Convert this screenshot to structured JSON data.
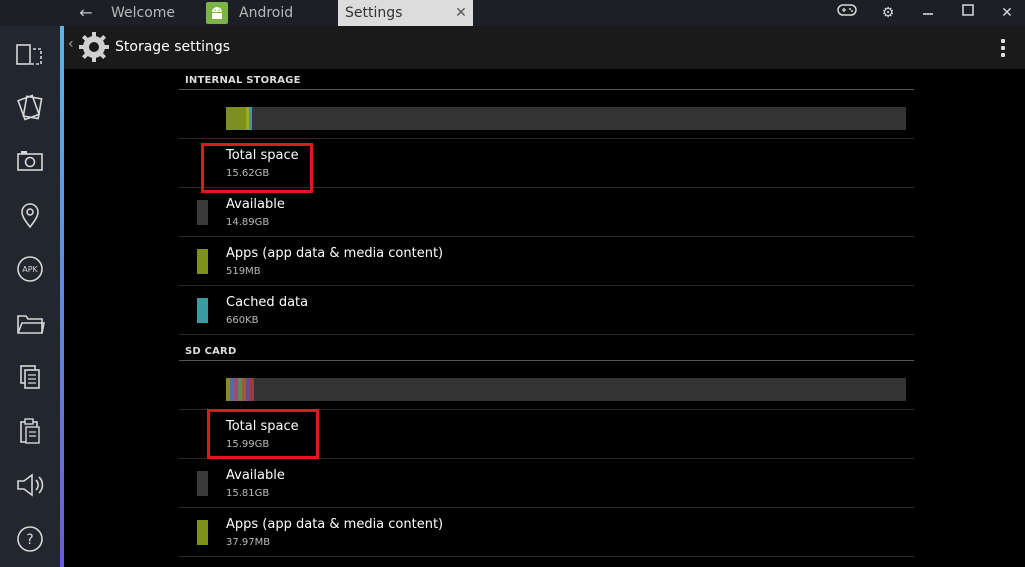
{
  "tabs": {
    "welcome": "Welcome",
    "android": "Android",
    "settings": "Settings"
  },
  "action_bar": {
    "title": "Storage settings"
  },
  "internal": {
    "header": "INTERNAL STORAGE",
    "usage": [
      {
        "name": "apps",
        "fraction": 0.03,
        "color": "#7d8f1c"
      },
      {
        "name": "other",
        "fraction": 0.004,
        "color": "#a0a820"
      },
      {
        "name": "cached",
        "fraction": 0.005,
        "color": "#3a9ca0"
      }
    ],
    "rows": [
      {
        "title": "Total space",
        "value": "15.62GB",
        "swatch": null
      },
      {
        "title": "Available",
        "value": "14.89GB",
        "swatch": "#3a3a3a"
      },
      {
        "title": "Apps (app data & media content)",
        "value": "519MB",
        "swatch": "#7d8f1c"
      },
      {
        "title": "Cached data",
        "value": "660KB",
        "swatch": "#3a9ca0"
      }
    ]
  },
  "sdcard": {
    "header": "SD CARD",
    "usage": [
      {
        "name": "s1",
        "fraction": 0.006,
        "color": "#8a8a2a"
      },
      {
        "name": "s2",
        "fraction": 0.006,
        "color": "#4a6fa0"
      },
      {
        "name": "s3",
        "fraction": 0.006,
        "color": "#a04a70"
      },
      {
        "name": "s4",
        "fraction": 0.006,
        "color": "#5a8a5a"
      },
      {
        "name": "s5",
        "fraction": 0.006,
        "color": "#a05a3a"
      },
      {
        "name": "s6",
        "fraction": 0.006,
        "color": "#6a4a8a"
      },
      {
        "name": "s7",
        "fraction": 0.006,
        "color": "#9a3a3a"
      }
    ],
    "rows": [
      {
        "title": "Total space",
        "value": "15.99GB",
        "swatch": null
      },
      {
        "title": "Available",
        "value": "15.81GB",
        "swatch": "#3a3a3a"
      },
      {
        "title": "Apps (app data & media content)",
        "value": "37.97MB",
        "swatch": "#7d8f1c"
      }
    ]
  },
  "colors": {
    "highlight": "#e0191f",
    "sidebar_bg": "#22262f",
    "accent_top": "#58b6e8",
    "accent_bottom": "#6a5bd8"
  },
  "icons": {
    "sidebar": [
      "rotate-icon",
      "cards-icon",
      "camera-icon",
      "location-icon",
      "apk-icon",
      "folder-icon",
      "copy-icon",
      "paste-icon",
      "volume-icon",
      "help-icon"
    ],
    "sidebar_apk_label": "APK",
    "sidebar_help_label": "?"
  }
}
